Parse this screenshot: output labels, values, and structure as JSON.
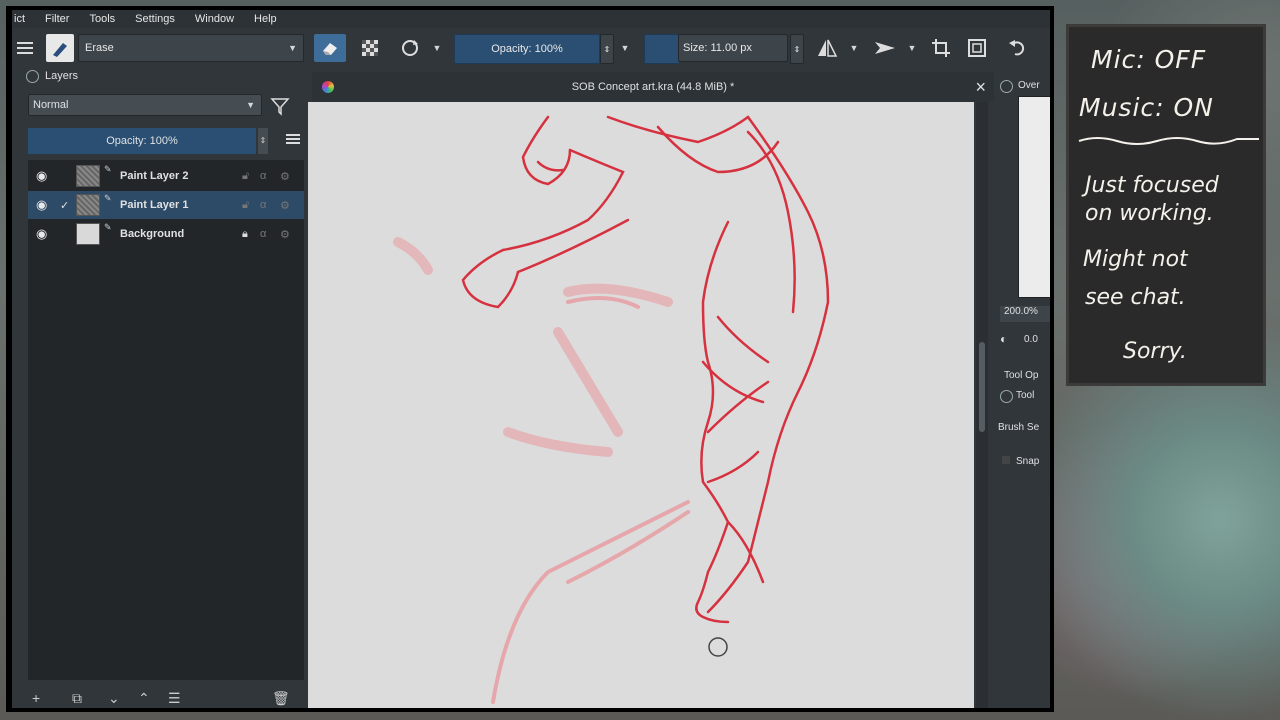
{
  "menu": {
    "items": [
      "ict",
      "Filter",
      "Tools",
      "Settings",
      "Window",
      "Help"
    ]
  },
  "toolbar": {
    "preset_name": "Erase",
    "opacity_label": "Opacity: 100%",
    "size_label": "Size: 11.00 px"
  },
  "layers": {
    "title": "Layers",
    "blend_mode": "Normal",
    "opacity_label": "Opacity:  100%",
    "items": [
      {
        "name": "Paint Layer 2",
        "visible": true,
        "selected": false
      },
      {
        "name": "Paint Layer 1",
        "visible": true,
        "selected": true
      },
      {
        "name": "Background",
        "visible": true,
        "selected": false
      }
    ]
  },
  "document": {
    "title": "SOB Concept art.kra (44.8 MiB) *",
    "close_glyph": "×"
  },
  "right_dock": {
    "overview_title": "Over",
    "zoom": "200.0%",
    "rotation": "0.0",
    "tool_options": "Tool Op",
    "tool_label": "Tool",
    "brush_settings": "Brush Se",
    "snap": "Snap"
  },
  "board": {
    "mic": "Mic: OFF",
    "music": "Music: ON",
    "line1": "Just focused",
    "line2": "on working.",
    "line3": "Might not",
    "line4": "see  chat.",
    "line5": "Sorry."
  },
  "colors": {
    "sketch": "#d6313f",
    "sketch_light": "#e99aa0",
    "selection": "#2d4a66",
    "accent_blue": "#2a4f72"
  },
  "icons": [
    "menu-icon",
    "brush-preset-icon",
    "eraser-icon",
    "alpha-lock-icon",
    "reset-rotation-icon",
    "mirror-icon",
    "transform-icon",
    "crop-icon",
    "wrap-icon",
    "undo-icon",
    "eye-icon",
    "filter-icon",
    "lock-icon",
    "close-icon"
  ]
}
